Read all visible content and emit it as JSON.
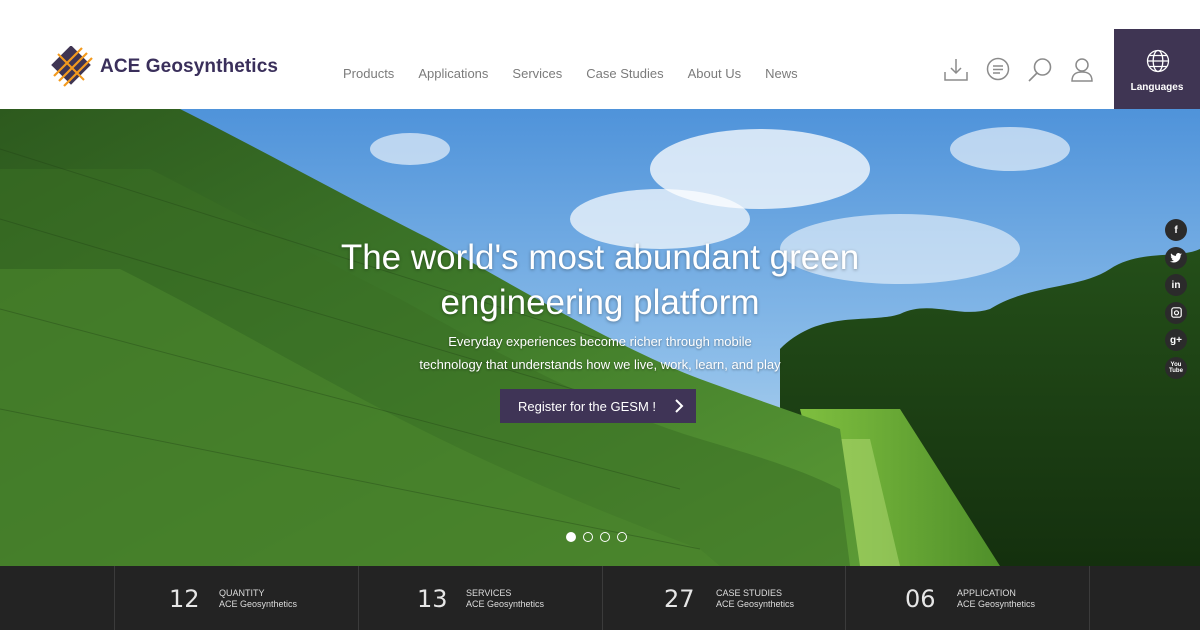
{
  "header": {
    "brand": "ACE Geosynthetics",
    "nav": [
      "Products",
      "Applications",
      "Services",
      "Case Studies",
      "About Us",
      "News"
    ],
    "tools": [
      "download-icon",
      "chat-icon",
      "search-icon",
      "user-icon"
    ],
    "languages_label": "Languages"
  },
  "hero": {
    "title_line1": "The world's most abundant green",
    "title_line2": "engineering platform",
    "subtitle_line1": "Everyday experiences become richer through mobile",
    "subtitle_line2": "technology that understands how we live, work, learn, and play",
    "cta_label": "Register for the GESM !",
    "slides_total": 4,
    "active_slide": 1
  },
  "social": [
    "f",
    "twitter-icon",
    "in",
    "instagram-icon",
    "g+",
    "You\nTube"
  ],
  "stats": [
    {
      "number": "12",
      "label1": "QUANTITY",
      "label2": "ACE Geosynthetics"
    },
    {
      "number": "13",
      "label1": "SERVICES",
      "label2": "ACE Geosynthetics"
    },
    {
      "number": "27",
      "label1": "CASE STUDIES",
      "label2": "ACE Geosynthetics"
    },
    {
      "number": "06",
      "label1": "APPLICATION",
      "label2": "ACE Geosynthetics"
    }
  ],
  "colors": {
    "brand_purple": "#3f3553",
    "logo_orange": "#f39a1e",
    "stats_bg": "#232323"
  }
}
